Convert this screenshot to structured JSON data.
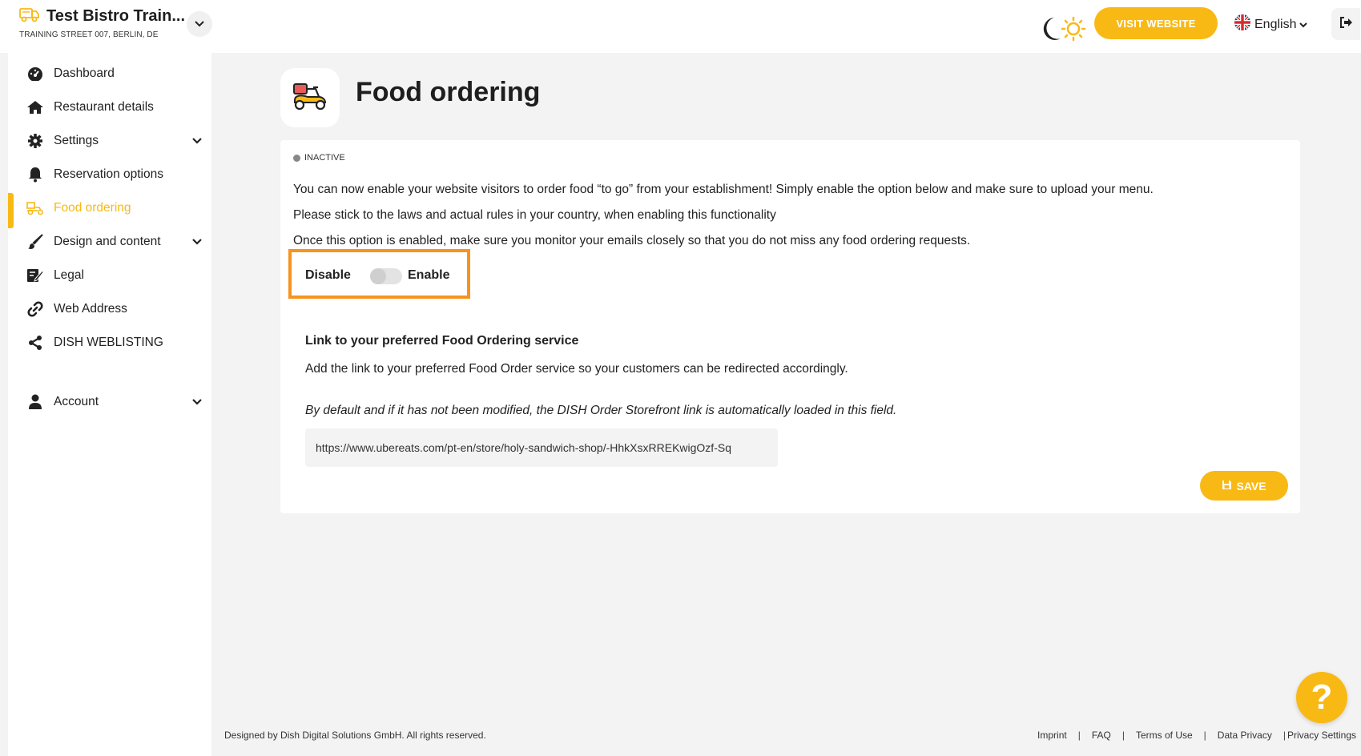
{
  "header": {
    "restaurant_name": "Test Bistro Train...",
    "restaurant_address": "TRAINING STREET 007, BERLIN, DE",
    "visit_website_label": "VISIT WEBSITE",
    "language": "English"
  },
  "sidebar": {
    "items": [
      {
        "label": "Dashboard",
        "icon": "dashboard-icon"
      },
      {
        "label": "Restaurant details",
        "icon": "home-icon"
      },
      {
        "label": "Settings",
        "icon": "gear-icon"
      },
      {
        "label": "Reservation options",
        "icon": "bell-icon"
      },
      {
        "label": "Food ordering",
        "icon": "scooter-icon"
      },
      {
        "label": "Design and content",
        "icon": "brush-icon"
      },
      {
        "label": "Legal",
        "icon": "legal-icon"
      },
      {
        "label": "Web Address",
        "icon": "link-icon"
      },
      {
        "label": "DISH WEBLISTING",
        "icon": "share-icon"
      },
      {
        "label": "Account",
        "icon": "user-icon"
      }
    ]
  },
  "main": {
    "title": "Food ordering",
    "status": "INACTIVE",
    "description_lines": [
      "You can now enable your website visitors to order food “to go” from your establishment! Simply enable the option below and make sure to upload your menu.",
      "Please stick to the laws and actual rules in your country, when enabling this functionality",
      "Once this option is enabled, make sure you monitor your emails closely so that you do not miss any food ordering requests."
    ],
    "toggle": {
      "off_label": "Disable",
      "on_label": "Enable",
      "enabled": false
    },
    "link_section": {
      "title": "Link to your preferred Food Ordering service",
      "description": "Add the link to your preferred Food Order service so your customers can be redirected accordingly.",
      "note": "By default and if it has not been modified, the DISH Order Storefront link is automatically loaded in this field.",
      "url_value": "https://www.ubereats.com/pt-en/store/holy-sandwich-shop/-HhkXsxRREKwigOzf-Sq"
    },
    "save_label": "SAVE"
  },
  "footer": {
    "copyright": "Designed by Dish Digital Solutions GmbH. All rights reserved.",
    "links": [
      "Imprint",
      "FAQ",
      "Terms of Use",
      "Data Privacy",
      "Privacy Settings"
    ]
  },
  "colors": {
    "accent": "#f9b915",
    "highlight_border": "#f7931e",
    "background": "#f3f3f3"
  }
}
